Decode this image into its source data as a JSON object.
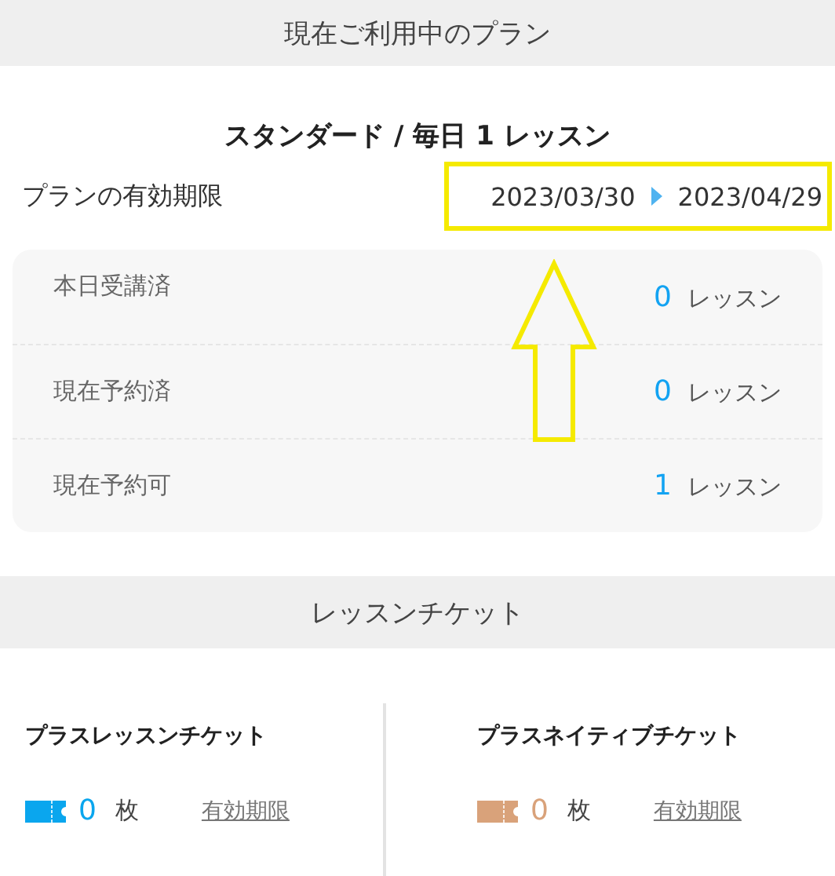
{
  "plan_section": {
    "heading": "現在ご利用中のプラン",
    "plan_name": "スタンダード / 毎日 1 レッスン",
    "validity_label": "プランの有効期限",
    "start_date": "2023/03/30",
    "end_date": "2023/04/29",
    "stats": [
      {
        "label": "本日受講済",
        "count": "0",
        "unit": "レッスン"
      },
      {
        "label": "現在予約済",
        "count": "0",
        "unit": "レッスン"
      },
      {
        "label": "現在予約可",
        "count": "1",
        "unit": "レッスン"
      }
    ]
  },
  "ticket_section": {
    "heading": "レッスンチケット",
    "tickets": [
      {
        "name": "プラスレッスンチケット",
        "count": "0",
        "unit": "枚",
        "link": "有効期限",
        "color": "#0aa6ee"
      },
      {
        "name": "プラスネイティブチケット",
        "count": "0",
        "unit": "枚",
        "link": "有効期限",
        "color": "#d9a27a"
      }
    ]
  }
}
